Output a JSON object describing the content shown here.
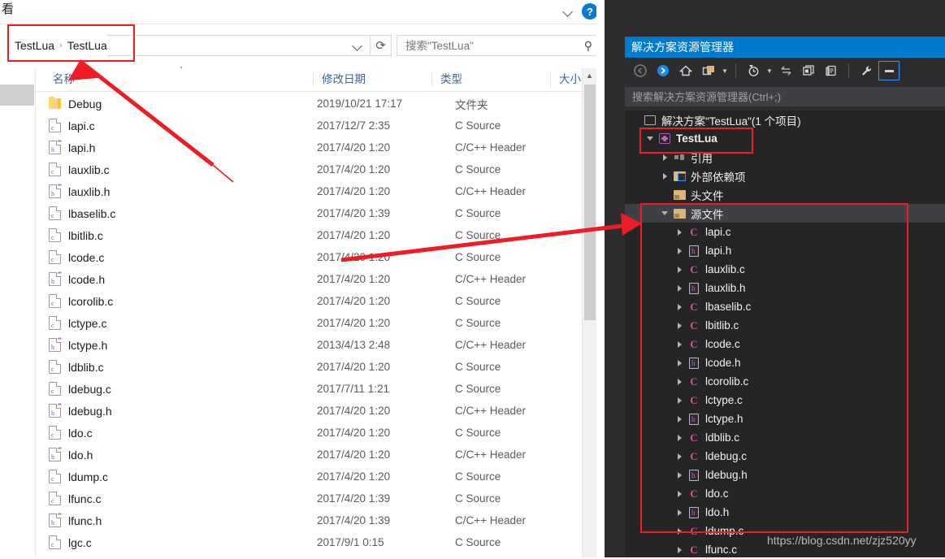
{
  "explorer": {
    "ribbon_tab_label": "看",
    "help_button": "?",
    "breadcrumb": {
      "items": [
        "TestLua",
        "TestLua"
      ],
      "separator": "›"
    },
    "address": {
      "dropdown_icon": "chevron-down",
      "refresh_icon": "⟳"
    },
    "search": {
      "placeholder": "搜索\"TestLua\"",
      "value": "",
      "icon": "search-icon"
    },
    "columns": [
      {
        "label": "名称",
        "key": "name"
      },
      {
        "label": "修改日期",
        "key": "date"
      },
      {
        "label": "类型",
        "key": "type"
      },
      {
        "label": "大小",
        "key": "size"
      }
    ],
    "sort_indicator": "ascending",
    "files": [
      {
        "name": "Debug",
        "icon": "folder-icon",
        "date": "2019/10/21 17:17",
        "type": "文件夹",
        "size": ""
      },
      {
        "name": "lapi.c",
        "icon": "c-source-icon",
        "date": "2017/12/7 2:35",
        "type": "C Source",
        "size": ""
      },
      {
        "name": "lapi.h",
        "icon": "c-header-icon",
        "date": "2017/4/20 1:20",
        "type": "C/C++ Header",
        "size": ""
      },
      {
        "name": "lauxlib.c",
        "icon": "c-source-icon",
        "date": "2017/4/20 1:20",
        "type": "C Source",
        "size": ""
      },
      {
        "name": "lauxlib.h",
        "icon": "c-header-icon",
        "date": "2017/4/20 1:20",
        "type": "C/C++ Header",
        "size": ""
      },
      {
        "name": "lbaselib.c",
        "icon": "c-source-icon",
        "date": "2017/4/20 1:39",
        "type": "C Source",
        "size": ""
      },
      {
        "name": "lbitlib.c",
        "icon": "c-source-icon",
        "date": "2017/4/20 1:20",
        "type": "C Source",
        "size": ""
      },
      {
        "name": "lcode.c",
        "icon": "c-source-icon",
        "date": "2017/4/20 1:20",
        "type": "C Source",
        "size": ""
      },
      {
        "name": "lcode.h",
        "icon": "c-header-icon",
        "date": "2017/4/20 1:20",
        "type": "C/C++ Header",
        "size": ""
      },
      {
        "name": "lcorolib.c",
        "icon": "c-source-icon",
        "date": "2017/4/20 1:20",
        "type": "C Source",
        "size": ""
      },
      {
        "name": "lctype.c",
        "icon": "c-source-icon",
        "date": "2017/4/20 1:20",
        "type": "C Source",
        "size": ""
      },
      {
        "name": "lctype.h",
        "icon": "c-header-icon",
        "date": "2013/4/13 2:48",
        "type": "C/C++ Header",
        "size": ""
      },
      {
        "name": "ldblib.c",
        "icon": "c-source-icon",
        "date": "2017/4/20 1:20",
        "type": "C Source",
        "size": ""
      },
      {
        "name": "ldebug.c",
        "icon": "c-source-icon",
        "date": "2017/7/11 1:21",
        "type": "C Source",
        "size": ""
      },
      {
        "name": "ldebug.h",
        "icon": "c-header-icon",
        "date": "2017/4/20 1:20",
        "type": "C/C++ Header",
        "size": ""
      },
      {
        "name": "ldo.c",
        "icon": "c-source-icon",
        "date": "2017/4/20 1:20",
        "type": "C Source",
        "size": ""
      },
      {
        "name": "ldo.h",
        "icon": "c-header-icon",
        "date": "2017/4/20 1:20",
        "type": "C/C++ Header",
        "size": ""
      },
      {
        "name": "ldump.c",
        "icon": "c-source-icon",
        "date": "2017/4/20 1:20",
        "type": "C Source",
        "size": ""
      },
      {
        "name": "lfunc.c",
        "icon": "c-source-icon",
        "date": "2017/4/20 1:39",
        "type": "C Source",
        "size": ""
      },
      {
        "name": "lfunc.h",
        "icon": "c-header-icon",
        "date": "2017/4/20 1:39",
        "type": "C/C++ Header",
        "size": ""
      },
      {
        "name": "lgc.c",
        "icon": "c-source-icon",
        "date": "2017/9/1 0:15",
        "type": "C Source",
        "size": ""
      }
    ]
  },
  "vs": {
    "panel_title": "解决方案资源管理器",
    "toolbar": [
      {
        "name": "back-icon",
        "glyph": "◀"
      },
      {
        "name": "forward-icon",
        "glyph": "▶"
      },
      {
        "name": "home-icon",
        "glyph": "⌂"
      },
      {
        "name": "show-all-files-icon",
        "glyph": "folder"
      },
      {
        "name": "pending-changes-icon",
        "glyph": "clock"
      },
      {
        "name": "sync-with-active-document-icon",
        "glyph": "⇆"
      },
      {
        "name": "properties-icon",
        "glyph": "▤"
      },
      {
        "name": "preview-selected-items-icon",
        "glyph": "▣"
      },
      {
        "name": "properties-window-icon",
        "glyph": "wrench"
      },
      {
        "name": "collapse-all-icon",
        "glyph": "▬"
      }
    ],
    "search_placeholder": "搜索解决方案资源管理器(Ctrl+;)",
    "tree": [
      {
        "label": "解决方案\"TestLua\"(1 个项目)",
        "icon": "solution-icon",
        "indent": 0,
        "twisty": "none",
        "bold": false,
        "selected": false
      },
      {
        "label": "TestLua",
        "icon": "project-icon",
        "indent": 1,
        "twisty": "down",
        "bold": true,
        "selected": false
      },
      {
        "label": "引用",
        "icon": "references-icon",
        "indent": 2,
        "twisty": "right",
        "bold": false,
        "selected": false
      },
      {
        "label": "外部依赖项",
        "icon": "external-dependencies-icon",
        "indent": 2,
        "twisty": "right",
        "bold": false,
        "selected": false
      },
      {
        "label": "头文件",
        "icon": "folder-icon",
        "indent": 2,
        "twisty": "none",
        "bold": false,
        "selected": false
      },
      {
        "label": "源文件",
        "icon": "folder-open-icon",
        "indent": 2,
        "twisty": "down",
        "bold": false,
        "selected": true
      },
      {
        "label": "lapi.c",
        "icon": "c-source-icon",
        "indent": 3,
        "twisty": "right",
        "bold": false,
        "selected": false
      },
      {
        "label": "lapi.h",
        "icon": "c-header-icon",
        "indent": 3,
        "twisty": "right",
        "bold": false,
        "selected": false
      },
      {
        "label": "lauxlib.c",
        "icon": "c-source-icon",
        "indent": 3,
        "twisty": "right",
        "bold": false,
        "selected": false
      },
      {
        "label": "lauxlib.h",
        "icon": "c-header-icon",
        "indent": 3,
        "twisty": "right",
        "bold": false,
        "selected": false
      },
      {
        "label": "lbaselib.c",
        "icon": "c-source-icon",
        "indent": 3,
        "twisty": "right",
        "bold": false,
        "selected": false
      },
      {
        "label": "lbitlib.c",
        "icon": "c-source-icon",
        "indent": 3,
        "twisty": "right",
        "bold": false,
        "selected": false
      },
      {
        "label": "lcode.c",
        "icon": "c-source-icon",
        "indent": 3,
        "twisty": "right",
        "bold": false,
        "selected": false
      },
      {
        "label": "lcode.h",
        "icon": "c-header-icon",
        "indent": 3,
        "twisty": "right",
        "bold": false,
        "selected": false
      },
      {
        "label": "lcorolib.c",
        "icon": "c-source-icon",
        "indent": 3,
        "twisty": "right",
        "bold": false,
        "selected": false
      },
      {
        "label": "lctype.c",
        "icon": "c-source-icon",
        "indent": 3,
        "twisty": "right",
        "bold": false,
        "selected": false
      },
      {
        "label": "lctype.h",
        "icon": "c-header-icon",
        "indent": 3,
        "twisty": "right",
        "bold": false,
        "selected": false
      },
      {
        "label": "ldblib.c",
        "icon": "c-source-icon",
        "indent": 3,
        "twisty": "right",
        "bold": false,
        "selected": false
      },
      {
        "label": "ldebug.c",
        "icon": "c-source-icon",
        "indent": 3,
        "twisty": "right",
        "bold": false,
        "selected": false
      },
      {
        "label": "ldebug.h",
        "icon": "c-header-icon",
        "indent": 3,
        "twisty": "right",
        "bold": false,
        "selected": false
      },
      {
        "label": "ldo.c",
        "icon": "c-source-icon",
        "indent": 3,
        "twisty": "right",
        "bold": false,
        "selected": false
      },
      {
        "label": "ldo.h",
        "icon": "c-header-icon",
        "indent": 3,
        "twisty": "right",
        "bold": false,
        "selected": false
      },
      {
        "label": "ldump.c",
        "icon": "c-source-icon",
        "indent": 3,
        "twisty": "right",
        "bold": false,
        "selected": false
      },
      {
        "label": "lfunc.c",
        "icon": "c-source-icon",
        "indent": 3,
        "twisty": "right",
        "bold": false,
        "selected": false
      }
    ]
  },
  "annotations": {
    "color": "#ee1c25",
    "boxes": [
      "breadcrumb-highlight",
      "testlua-project-highlight",
      "source-files-highlight"
    ],
    "arrows": [
      "breadcrumb-arrow",
      "source-files-arrow"
    ]
  },
  "watermark": "https://blog.csdn.net/zjz520yy"
}
